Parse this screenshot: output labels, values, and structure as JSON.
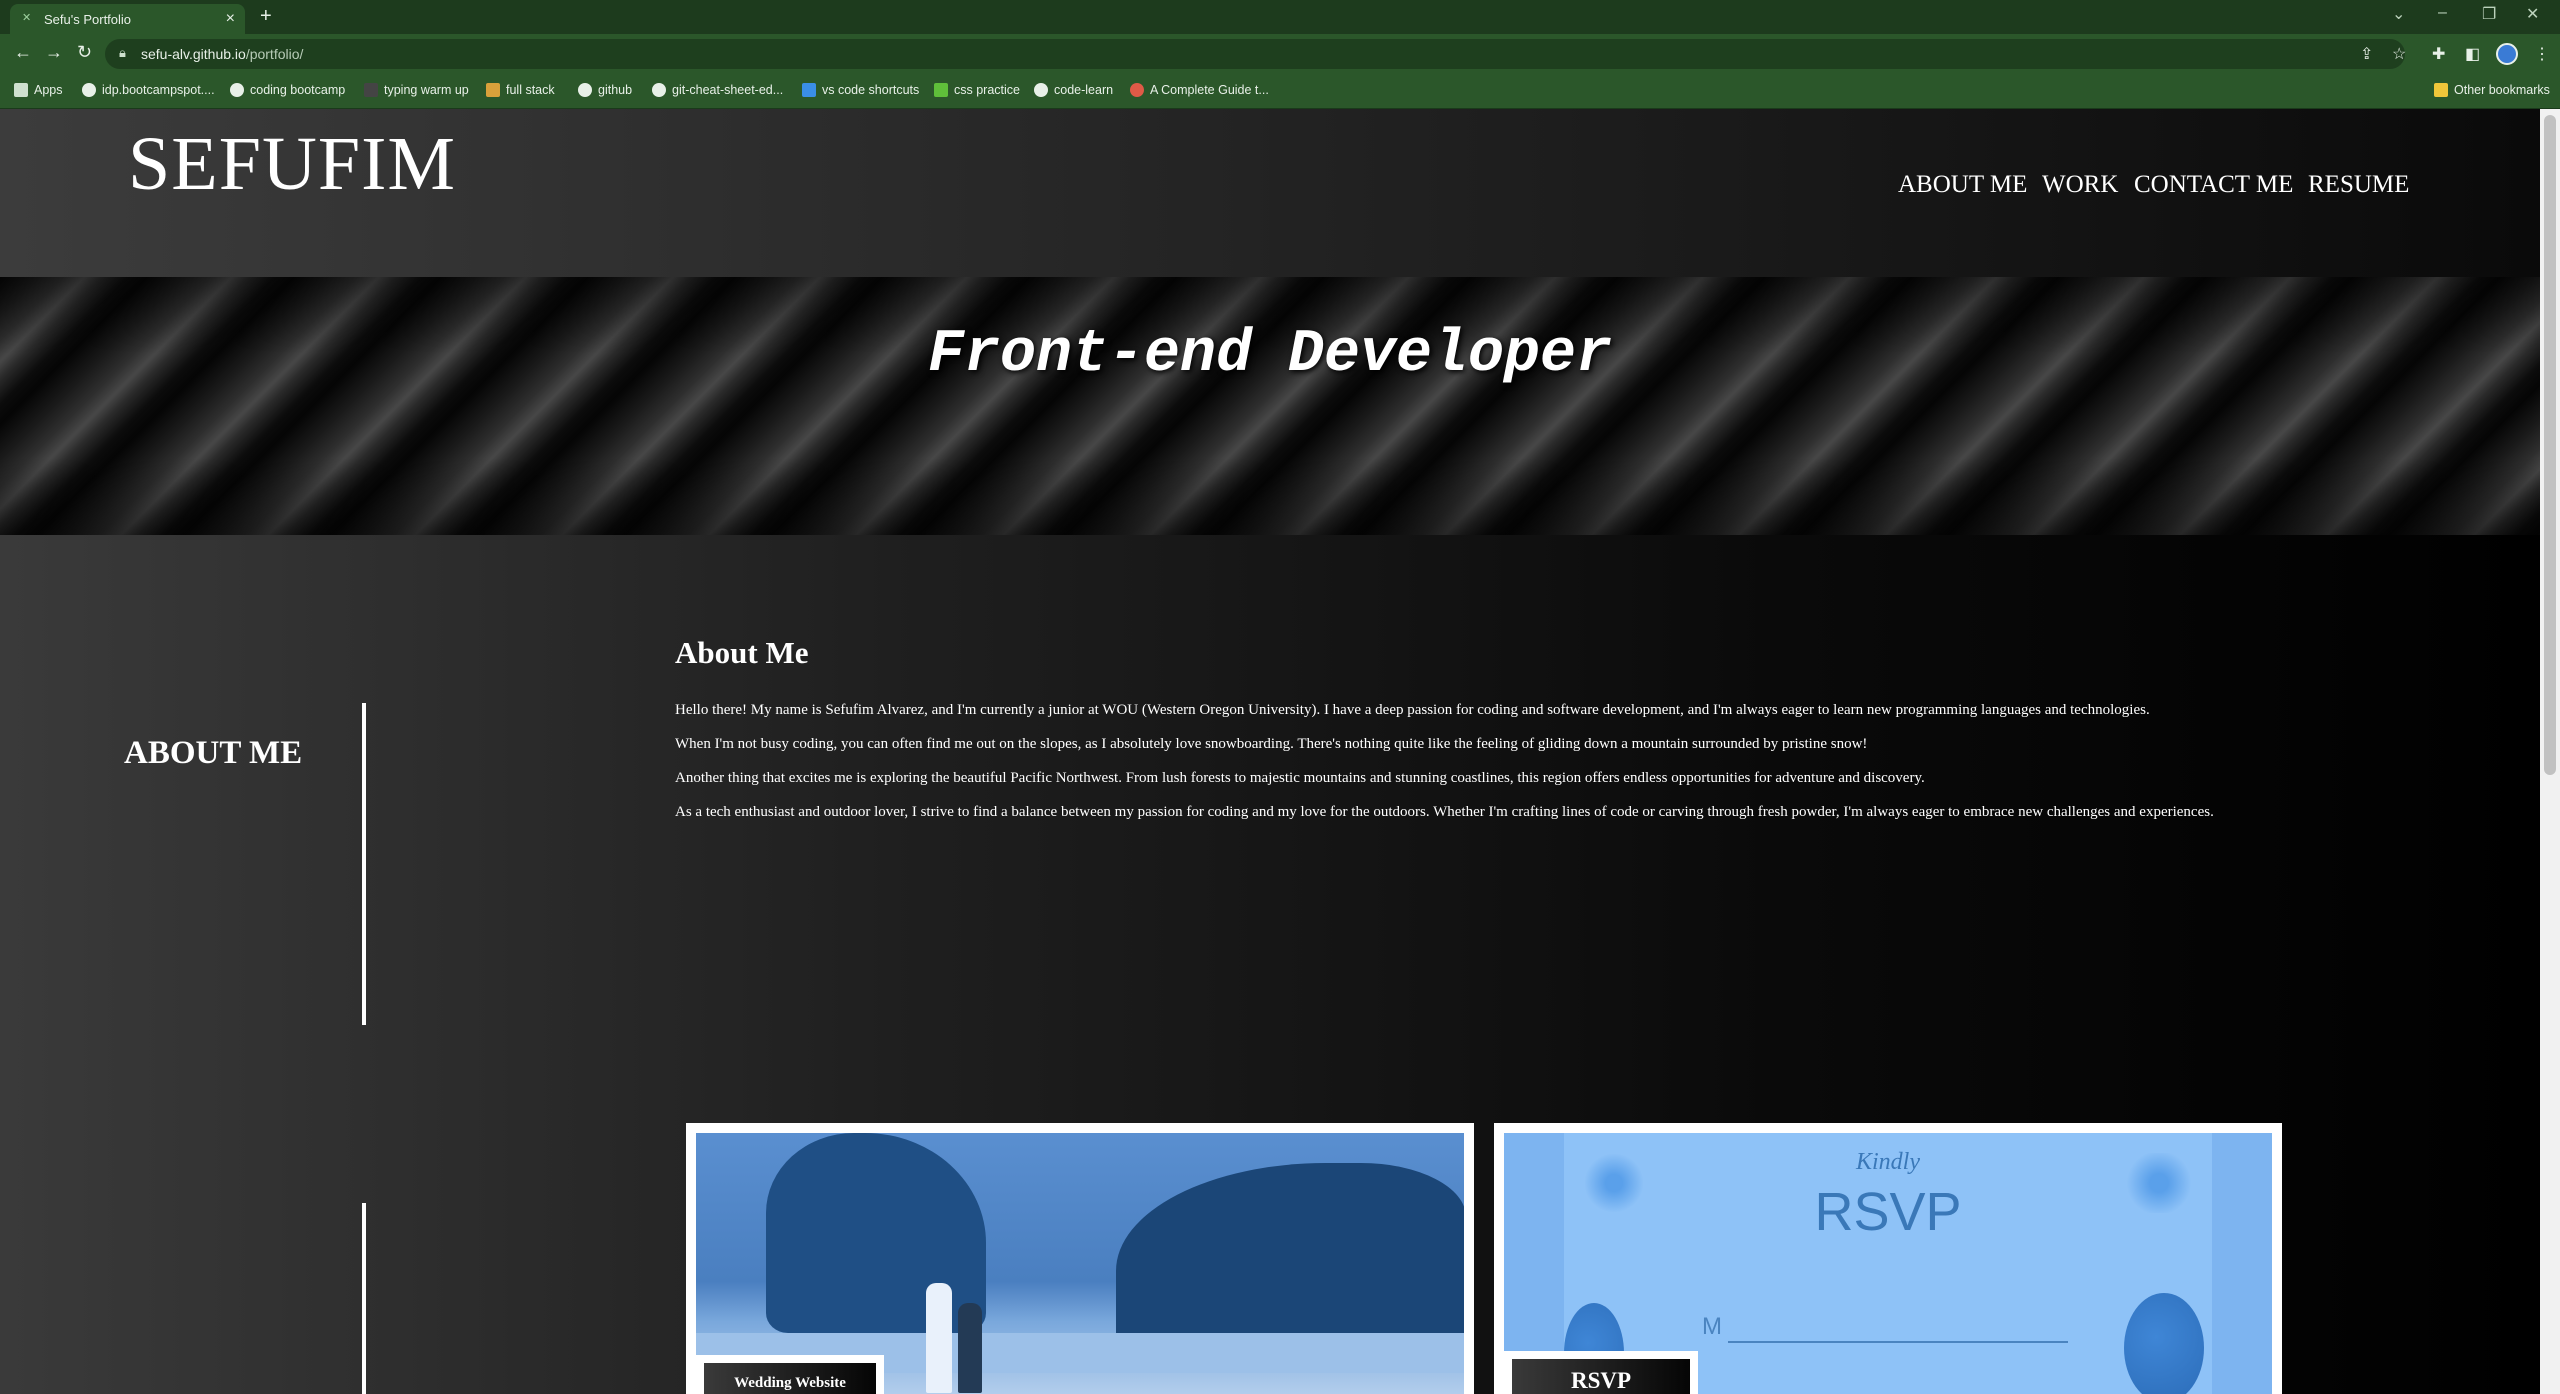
{
  "browser": {
    "tab_title": "Sefu's Portfolio",
    "url_host": "sefu-alv.github.io",
    "url_path": "/portfolio/",
    "bookmarks": [
      "Apps",
      "idp.bootcampspot....",
      "coding bootcamp",
      "typing warm up",
      "full stack",
      "github",
      "git-cheat-sheet-ed...",
      "vs code shortcuts",
      "css practice",
      "code-learn",
      "A Complete Guide t..."
    ],
    "other_bookmarks": "Other bookmarks"
  },
  "header": {
    "logo": "SEFUFIM",
    "nav": [
      "ABOUT ME",
      "WORK",
      "CONTACT ME",
      "RESUME"
    ]
  },
  "hero": {
    "title": "Front-end Developer"
  },
  "about": {
    "side_title": "ABOUT ME",
    "heading": "About Me",
    "paragraphs": [
      "Hello there! My name is Sefufim Alvarez, and I'm currently a junior at WOU (Western Oregon University). I have a deep passion for coding and software development, and I'm always eager to learn new programming languages and technologies.",
      "When I'm not busy coding, you can often find me out on the slopes, as I absolutely love snowboarding. There's nothing quite like the feeling of gliding down a mountain surrounded by pristine snow!",
      "Another thing that excites me is exploring the beautiful Pacific Northwest. From lush forests to majestic mountains and stunning coastlines, this region offers endless opportunities for adventure and discovery.",
      "As a tech enthusiast and outdoor lover, I strive to find a balance between my passion for coding and my love for the outdoors. Whether I'm crafting lines of code or carving through fresh powder, I'm always eager to embrace new challenges and experiences."
    ]
  },
  "work": {
    "projects": [
      {
        "label": "Wedding Website"
      },
      {
        "label": "RSVP",
        "image_text_script": "Kindly",
        "image_text_main": "RSVP",
        "image_text_field": "M"
      }
    ]
  }
}
